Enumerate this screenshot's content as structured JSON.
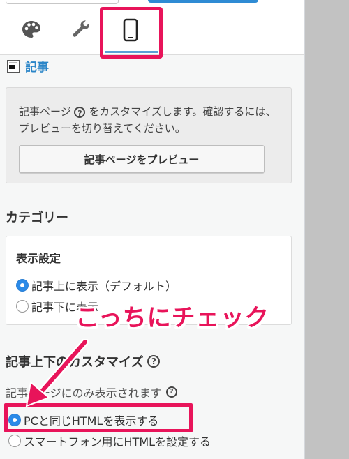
{
  "header": {
    "tabs": [
      {
        "name": "design",
        "icon": "palette-icon"
      },
      {
        "name": "settings",
        "icon": "wrench-icon"
      },
      {
        "name": "smartphone",
        "icon": "mobile-icon",
        "active": true
      }
    ]
  },
  "section": {
    "title": "記事",
    "info_text_before": "記事ページ",
    "info_text_after": "をカスタマイズします。確認するには、プレビューを切り替えてください。",
    "preview_button": "記事ページをプレビュー"
  },
  "category": {
    "title": "カテゴリー",
    "display_settings_title": "表示設定",
    "options": [
      {
        "label": "記事上に表示（デフォルト）",
        "checked": true
      },
      {
        "label": "記事下に表示",
        "checked": false
      }
    ]
  },
  "customize": {
    "title": "記事上下のカスタマイズ",
    "only_article_text": "記事ページにのみ表示されます",
    "options": [
      {
        "label": "PCと同じHTMLを表示する",
        "checked": true
      },
      {
        "label": "スマートフォン用にHTMLを設定する",
        "checked": false
      }
    ]
  },
  "annotation": {
    "callout_text": "こっちにチェック",
    "accent_color": "#e8145a"
  },
  "colors": {
    "link_blue": "#2b86c8",
    "radio_blue": "#2a8ae8"
  }
}
